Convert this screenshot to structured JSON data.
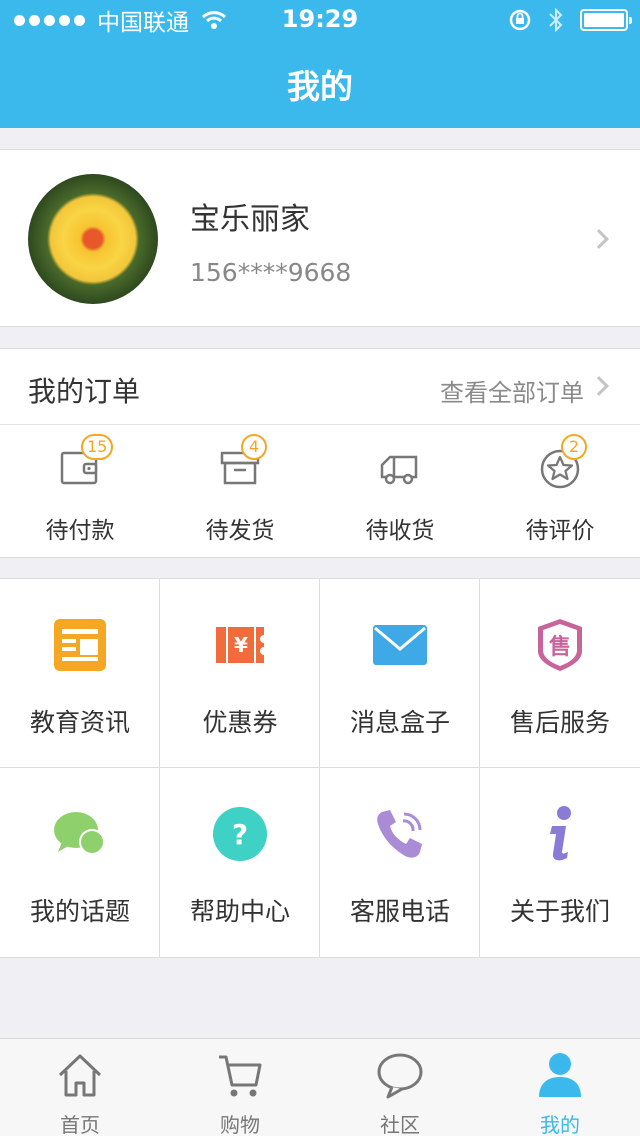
{
  "status_bar": {
    "carrier": "中国联通",
    "time": "19:29"
  },
  "header": {
    "title": "我的"
  },
  "profile": {
    "name": "宝乐丽家",
    "phone": "156****9668"
  },
  "orders": {
    "title": "我的订单",
    "view_all": "查看全部订单",
    "items": [
      {
        "label": "待付款",
        "badge": "15",
        "icon": "wallet-icon"
      },
      {
        "label": "待发货",
        "badge": "4",
        "icon": "box-icon"
      },
      {
        "label": "待收货",
        "badge": "",
        "icon": "truck-icon"
      },
      {
        "label": "待评价",
        "badge": "2",
        "icon": "star-icon"
      }
    ]
  },
  "grid": {
    "items": [
      {
        "label": "教育资讯",
        "icon": "news-icon",
        "color": "#f5a623"
      },
      {
        "label": "优惠券",
        "icon": "coupon-icon",
        "color": "#f26b3a"
      },
      {
        "label": "消息盒子",
        "icon": "mail-icon",
        "color": "#3fa9e8"
      },
      {
        "label": "售后服务",
        "icon": "after-sale-shield-icon",
        "color": "#c9649a"
      },
      {
        "label": "我的话题",
        "icon": "chat-bubbles-icon",
        "color": "#8ed16c"
      },
      {
        "label": "帮助中心",
        "icon": "help-question-icon",
        "color": "#3fd1c6"
      },
      {
        "label": "客服电话",
        "icon": "phone-icon",
        "color": "#a98bd6"
      },
      {
        "label": "关于我们",
        "icon": "info-icon",
        "color": "#8b7bd8"
      }
    ]
  },
  "tabbar": {
    "items": [
      {
        "label": "首页",
        "icon": "home-icon"
      },
      {
        "label": "购物",
        "icon": "cart-icon"
      },
      {
        "label": "社区",
        "icon": "speech-bubble-icon"
      },
      {
        "label": "我的",
        "icon": "user-icon",
        "active": true
      }
    ]
  },
  "colors": {
    "brand": "#3bb9ec",
    "badge": "#f5a623"
  }
}
